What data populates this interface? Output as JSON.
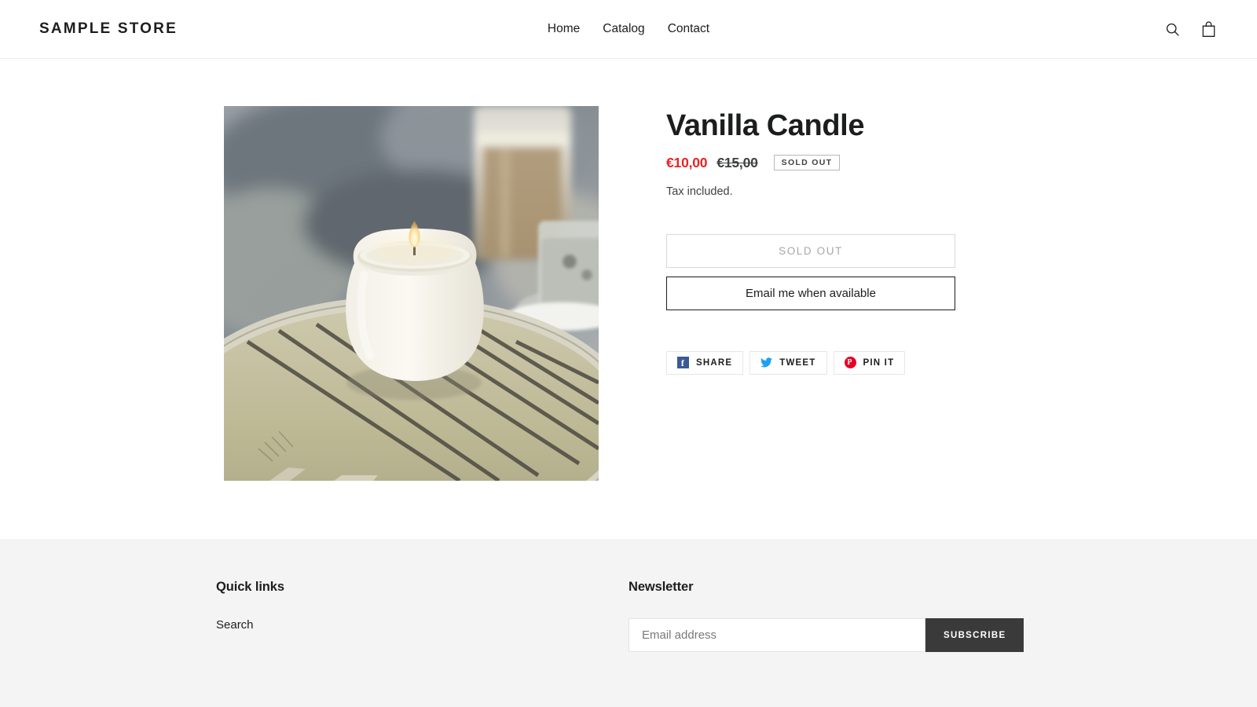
{
  "header": {
    "brand": "SAMPLE STORE",
    "nav": [
      {
        "label": "Home"
      },
      {
        "label": "Catalog"
      },
      {
        "label": "Contact"
      }
    ],
    "icons": {
      "search": "search-icon",
      "cart": "shopping-bag-icon"
    }
  },
  "product": {
    "title": "Vanilla Candle",
    "price_sale": "€10,00",
    "price_compare": "€15,00",
    "availability_badge": "SOLD OUT",
    "tax_note": "Tax included.",
    "sold_out_button": "SOLD OUT",
    "notify_button": "Email me when available",
    "image_alt": "Lit white vanilla candle on a slatted wicker table with a glass of coffee and a jar behind it"
  },
  "share": {
    "buttons": [
      {
        "label": "SHARE",
        "icon": "facebook-icon",
        "glyph": "f",
        "color": "#3b5998"
      },
      {
        "label": "TWEET",
        "icon": "twitter-icon",
        "glyph": "",
        "color": "#1da1f2"
      },
      {
        "label": "PIN IT",
        "icon": "pinterest-icon",
        "glyph": "P",
        "color": "#e60023"
      }
    ]
  },
  "footer": {
    "quick_links": {
      "heading": "Quick links",
      "links": [
        {
          "label": "Search"
        }
      ]
    },
    "newsletter": {
      "heading": "Newsletter",
      "email_placeholder": "Email address",
      "email_value": "",
      "subscribe_label": "SUBSCRIBE"
    }
  },
  "colors": {
    "sale_price": "#eb2222",
    "text": "#1c1d1d",
    "footer_bg": "#f4f4f4",
    "subscribe_bg": "#3a3a3a"
  }
}
